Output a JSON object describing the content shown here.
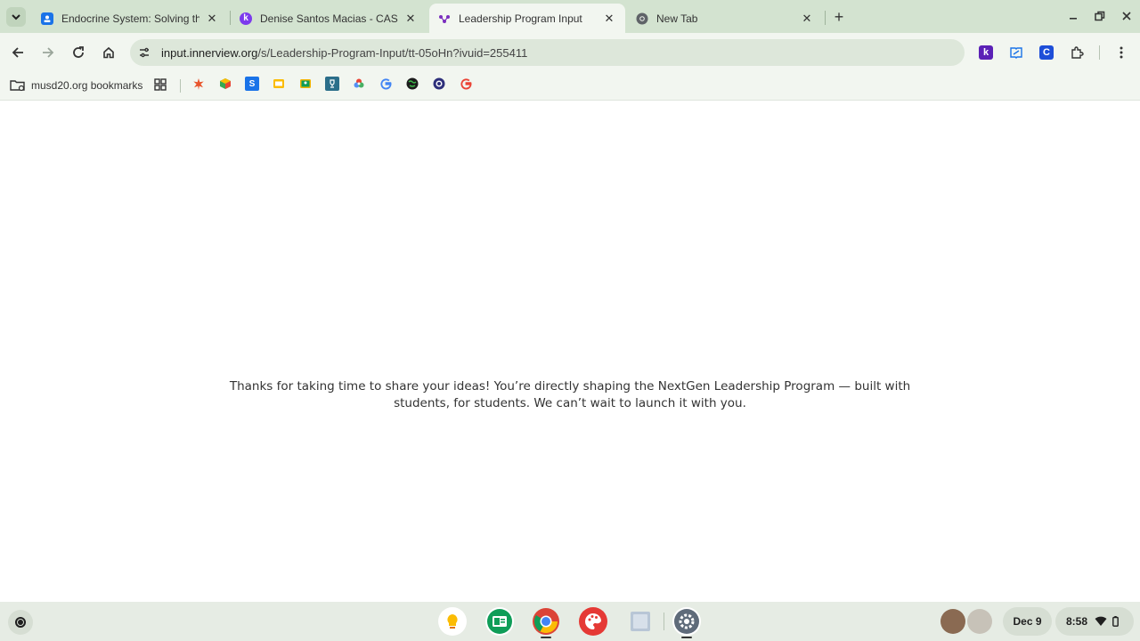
{
  "tabs": [
    {
      "title": "Endocrine System: Solving the",
      "favicon": "classroom-icon",
      "active": false
    },
    {
      "title": "Denise Santos Macias - CASE S",
      "favicon": "kami-icon",
      "active": false
    },
    {
      "title": "Leadership Program Input",
      "favicon": "innerview-icon",
      "active": true
    },
    {
      "title": "New Tab",
      "favicon": "chrome-icon",
      "active": false
    }
  ],
  "tab_close_glyph": "✕",
  "new_tab_glyph": "+",
  "omnibox": {
    "domain": "input.innerview.org",
    "path": "/s/Leadership-Program-Input/tt-05oHn?ivuid=255411"
  },
  "bookmarks": {
    "folder_label": "musd20.org bookmarks",
    "icons": [
      "asterisk-icon",
      "cube-icon",
      "schoology-icon",
      "slides-icon",
      "classroom-icon",
      "trophy-icon",
      "colorwheel-icon",
      "google-icon",
      "globe-icon",
      "circle-app-icon",
      "google-icon"
    ]
  },
  "page": {
    "message": "Thanks for taking  time to share your ideas! You’re directly shaping the NextGen Leadership Program — built with students, for students. We can’t wait to launch it with you."
  },
  "shelf": {
    "apps": [
      "keep-icon",
      "classroom-app-icon",
      "chrome-icon",
      "canvas-icon",
      "files-icon",
      "settings-icon"
    ],
    "date": "Dec 9",
    "time": "8:58"
  },
  "colors": {
    "tabstrip": "#d3e3d0",
    "toolbar": "#f2f6f0",
    "omnibox": "#dde7da",
    "shelf": "#e6ece4"
  }
}
